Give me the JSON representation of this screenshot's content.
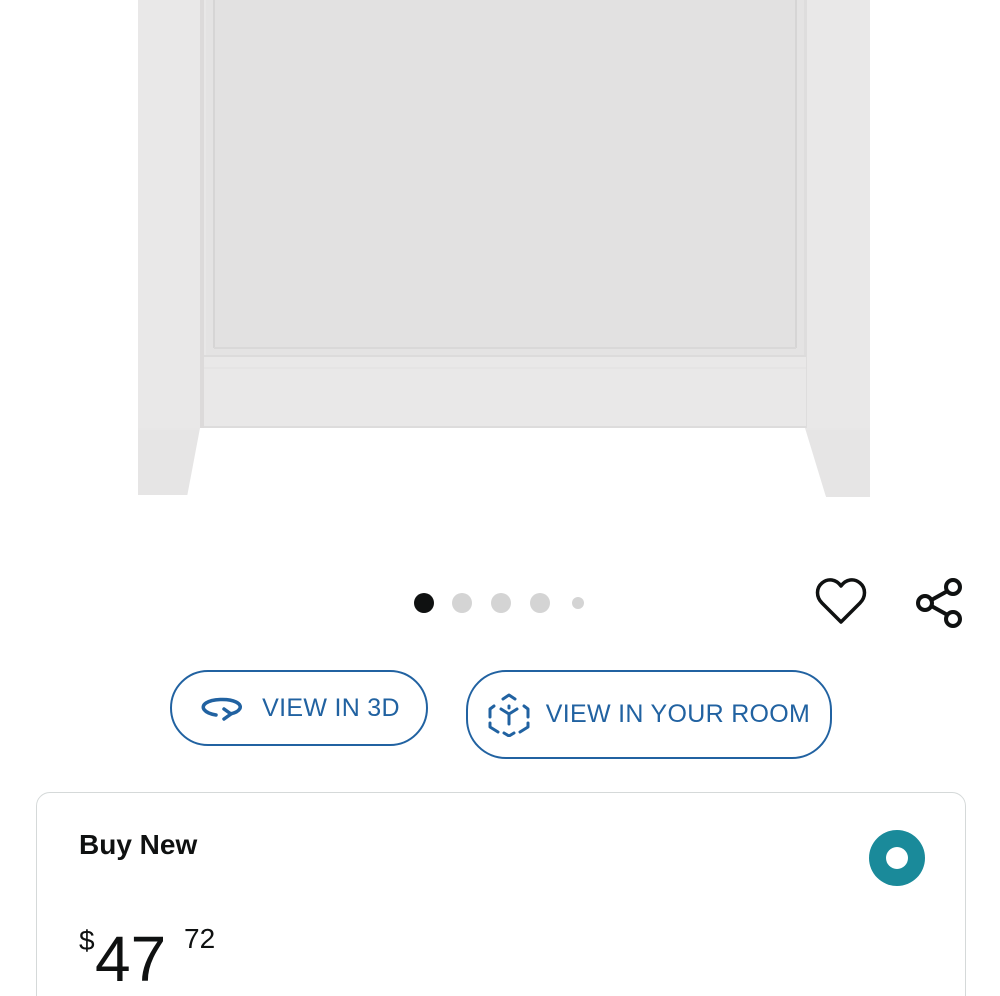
{
  "carousel": {
    "slide_count": 5,
    "active_index": 0
  },
  "actions": {
    "wishlist_icon": "heart-outline-icon",
    "share_icon": "share-icon"
  },
  "buttons": {
    "view_3d_label": "VIEW IN 3D",
    "view_3d_icon": "rotate-3d-icon",
    "view_room_label": "VIEW IN YOUR ROOM",
    "view_room_icon": "ar-cube-icon"
  },
  "buy_box": {
    "title": "Buy New",
    "selected": true,
    "price": {
      "symbol": "$",
      "whole": "47",
      "fraction": "72"
    }
  },
  "colors": {
    "accent_blue": "#2162a1",
    "radio_teal": "#1a8a9a",
    "text": "#0f1111"
  }
}
